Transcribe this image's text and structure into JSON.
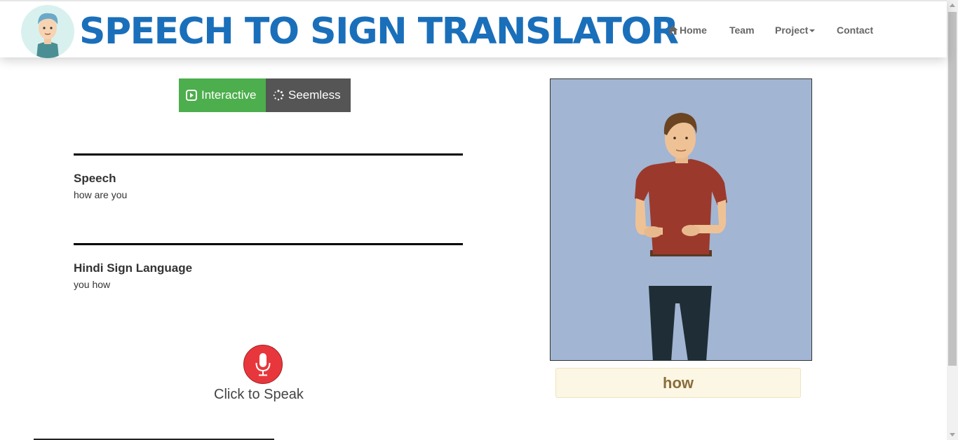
{
  "header": {
    "brand_title": "SPEECH TO SIGN TRANSLATOR",
    "brand_color": "#1a6fba",
    "logo_icon": "boy-avatar-icon",
    "nav": {
      "home": "Home",
      "team": "Team",
      "project": "Project",
      "contact": "Contact"
    }
  },
  "modes": {
    "interactive_label": "Interactive",
    "seemless_label": "Seemless",
    "interactive_icon": "play-square-icon",
    "seemless_icon": "spinner-icon",
    "active_color": "#4cae4c",
    "inactive_color": "#555555"
  },
  "speech": {
    "title": "Speech",
    "text": "how are you"
  },
  "sign": {
    "title": "Hindi Sign Language",
    "text": "you how"
  },
  "mic": {
    "label": "Click to Speak",
    "icon": "microphone-icon",
    "color": "#e8373c"
  },
  "avatar": {
    "background": "#a2b5d3",
    "current_word": "how"
  }
}
